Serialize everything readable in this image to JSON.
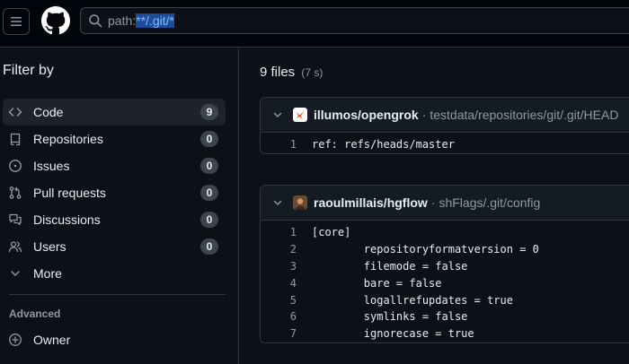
{
  "search": {
    "prefix": "path:",
    "highlight": "**/.git/*"
  },
  "sidebar": {
    "title": "Filter by",
    "items": [
      {
        "label": "Code",
        "count": "9",
        "icon": "code-icon"
      },
      {
        "label": "Repositories",
        "count": "0",
        "icon": "repo-icon"
      },
      {
        "label": "Issues",
        "count": "0",
        "icon": "issue-icon"
      },
      {
        "label": "Pull requests",
        "count": "0",
        "icon": "pull-request-icon"
      },
      {
        "label": "Discussions",
        "count": "0",
        "icon": "discussion-icon"
      },
      {
        "label": "Users",
        "count": "0",
        "icon": "people-icon"
      },
      {
        "label": "More",
        "icon": "chevron-down-icon"
      }
    ],
    "advanced_title": "Advanced",
    "advanced_items": [
      {
        "label": "Owner",
        "icon": "plus-circle-icon"
      }
    ]
  },
  "results": {
    "count_label": "9 files",
    "time": "(7 s)"
  },
  "cards": [
    {
      "repo": "illumos/opengrok",
      "sep": "·",
      "path": "testdata/repositories/git/.git/HEAD",
      "lines": [
        {
          "n": "1",
          "text": "ref: refs/heads/master"
        }
      ]
    },
    {
      "repo": "raoulmillais/hgflow",
      "sep": "·",
      "path": "shFlags/.git/config",
      "lines": [
        {
          "n": "1",
          "text": "[core]"
        },
        {
          "n": "2",
          "text": "        repositoryformatversion = 0"
        },
        {
          "n": "3",
          "text": "        filemode = false"
        },
        {
          "n": "4",
          "text": "        bare = false"
        },
        {
          "n": "5",
          "text": "        logallrefupdates = true"
        },
        {
          "n": "6",
          "text": "        symlinks = false"
        },
        {
          "n": "7",
          "text": "        ignorecase = true"
        }
      ]
    }
  ],
  "colors": {
    "background": "#0d1117",
    "topbar": "#010409",
    "border": "#30363d",
    "highlight": "#1f4c9a"
  }
}
